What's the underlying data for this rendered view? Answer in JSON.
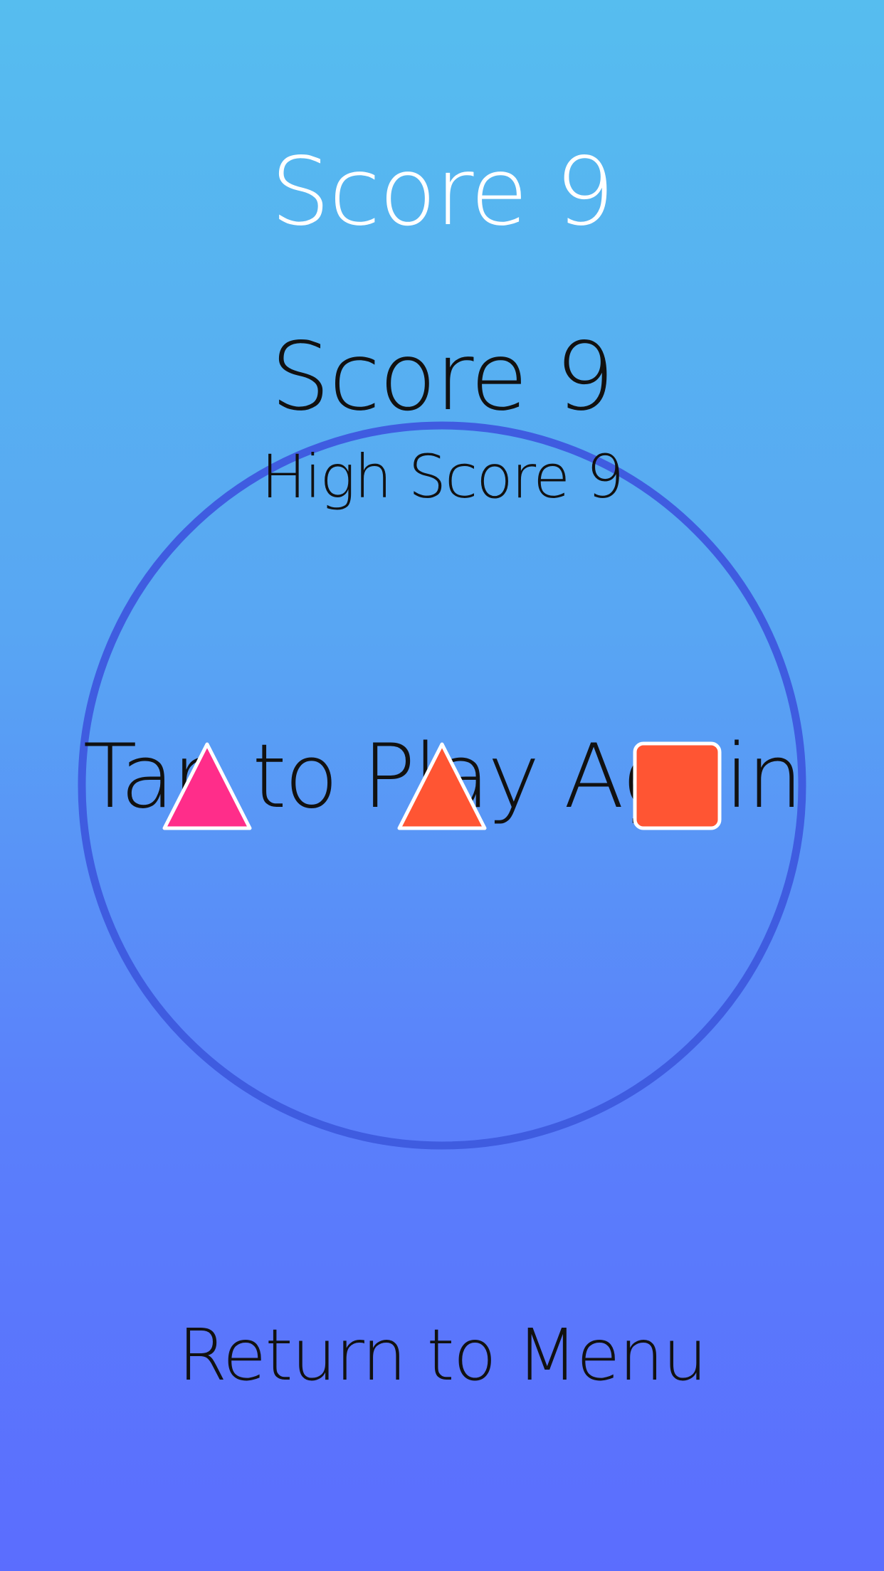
{
  "hud": {
    "score_text": "Score 9"
  },
  "game_over": {
    "score_text": "Score 9",
    "high_score_text": "High Score 9",
    "play_again_label": "Tap to Play Again",
    "return_menu_label": "Return to Menu"
  },
  "colors": {
    "background_top": "#56bdef",
    "background_bottom": "#5b6dfe",
    "ring": "#3f5ce0",
    "triangle_pink": "#ff2d8a",
    "triangle_orange": "#ff5533",
    "square_orange": "#ff5533",
    "shape_outline": "#ffffff"
  },
  "shapes": [
    {
      "type": "triangle",
      "color": "pink"
    },
    {
      "type": "triangle",
      "color": "orange"
    },
    {
      "type": "square",
      "color": "orange"
    }
  ]
}
